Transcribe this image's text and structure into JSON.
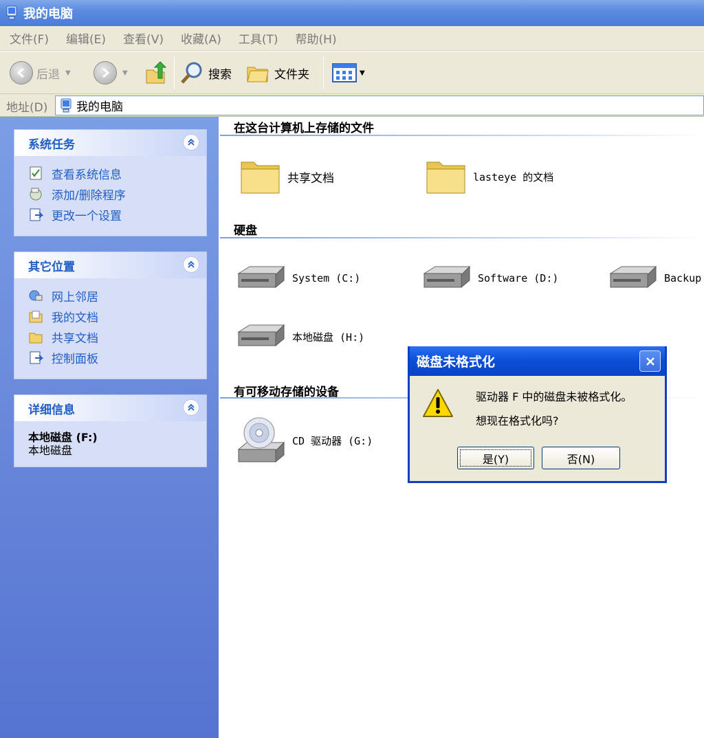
{
  "window": {
    "title": "我的电脑"
  },
  "menu": [
    "文件(F)",
    "编辑(E)",
    "查看(V)",
    "收藏(A)",
    "工具(T)",
    "帮助(H)"
  ],
  "toolbar": {
    "back": "后退",
    "search": "搜索",
    "folders": "文件夹"
  },
  "address": {
    "label": "地址(D)",
    "value": "我的电脑"
  },
  "left": {
    "system_tasks": {
      "title": "系统任务",
      "items": [
        "查看系统信息",
        "添加/删除程序",
        "更改一个设置"
      ]
    },
    "other_places": {
      "title": "其它位置",
      "items": [
        "网上邻居",
        "我的文档",
        "共享文档",
        "控制面板"
      ]
    },
    "details": {
      "title": "详细信息",
      "name": "本地磁盘 (F:)",
      "type": "本地磁盘"
    }
  },
  "content": {
    "files_section": "在这台计算机上存储的文件",
    "files": [
      "共享文档",
      "lasteye 的文档"
    ],
    "drives_section": "硬盘",
    "drives": [
      "System (C:)",
      "Software (D:)",
      "Backup",
      "本地磁盘 (H:)"
    ],
    "removable_section": "有可移动存储的设备",
    "removable": [
      "CD 驱动器 (G:)"
    ]
  },
  "dialog": {
    "title": "磁盘未格式化",
    "message1": "驱动器 F 中的磁盘未被格式化。",
    "message2": "想现在格式化吗?",
    "yes": "是(Y)",
    "no": "否(N)"
  }
}
